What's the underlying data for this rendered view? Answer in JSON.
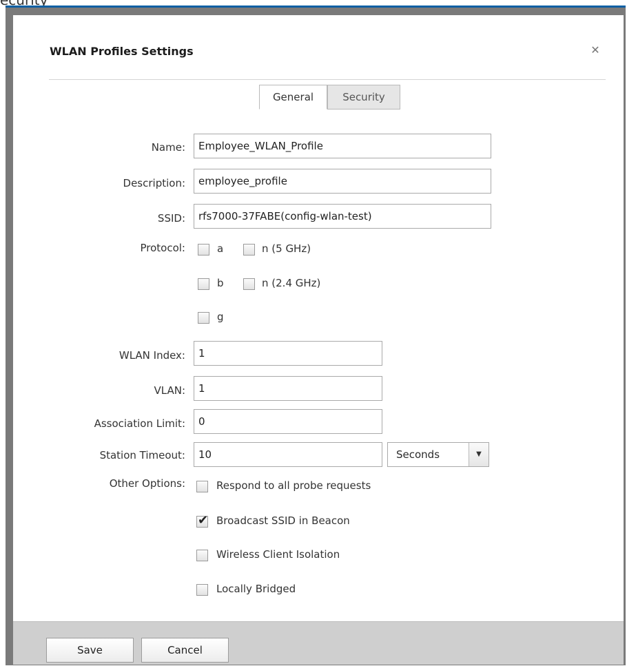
{
  "background": {
    "partial_text": "ecurity"
  },
  "dialog": {
    "title": "WLAN Profiles Settings",
    "close_icon": "close-icon",
    "tabs": [
      {
        "label": "General",
        "active": true
      },
      {
        "label": "Security",
        "active": false
      }
    ]
  },
  "form": {
    "name": {
      "label": "Name:",
      "value": "Employee_WLAN_Profile"
    },
    "description": {
      "label": "Description:",
      "value": "employee_profile"
    },
    "ssid": {
      "label": "SSID:",
      "value": "rfs7000-37FABE(config-wlan-test)"
    },
    "protocol": {
      "label": "Protocol:",
      "options": [
        {
          "label": "a",
          "checked": false
        },
        {
          "label": "n (5 GHz)",
          "checked": false
        },
        {
          "label": "b",
          "checked": false
        },
        {
          "label": "n (2.4 GHz)",
          "checked": false
        },
        {
          "label": "g",
          "checked": false
        }
      ]
    },
    "wlan_index": {
      "label": "WLAN Index:",
      "value": "1"
    },
    "vlan": {
      "label": "VLAN:",
      "value": "1"
    },
    "association_limit": {
      "label": "Association Limit:",
      "value": "0"
    },
    "station_timeout": {
      "label": "Station Timeout:",
      "value": "10",
      "unit": "Seconds"
    },
    "other_options": {
      "label": "Other Options:",
      "options": [
        {
          "label": "Respond to all probe requests",
          "checked": false
        },
        {
          "label": "Broadcast SSID in Beacon",
          "checked": true
        },
        {
          "label": "Wireless Client Isolation",
          "checked": false
        },
        {
          "label": "Locally Bridged",
          "checked": false
        }
      ]
    }
  },
  "footer": {
    "save_label": "Save",
    "cancel_label": "Cancel"
  },
  "colors": {
    "accent": "#0a5fa4",
    "frame": "#7a7a7a",
    "footer": "#cfcfcf"
  }
}
